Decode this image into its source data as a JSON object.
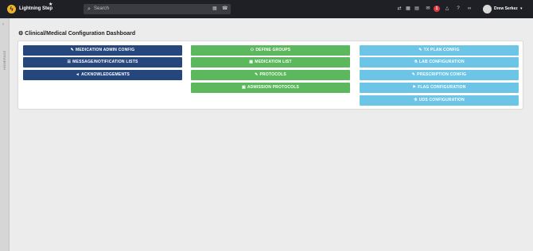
{
  "topbar": {
    "brand": "Lightning Step",
    "logo_glyph": "ϟ",
    "star_glyph": "★",
    "search_icon_glyph": "⌕",
    "search_placeholder": "Search",
    "calendar_glyph": "▦",
    "phone_glyph": "☎",
    "icons": {
      "transfer": "⇄",
      "calendar": "▦",
      "grid": "▤",
      "chat": "✉",
      "bell": "△",
      "help": "?",
      "link": "∞"
    },
    "notification_count": "1",
    "username": "Drew Serkez",
    "caret_glyph": "▾"
  },
  "sidebar": {
    "chevron_glyph": "‹",
    "label": "HOMEPAGE"
  },
  "page": {
    "title_icon_glyph": "⚙",
    "title": "Clinical/Medical Configuration Dashboard"
  },
  "buttons": {
    "col1": [
      {
        "icon": "✎",
        "label": "MEDICATION ADMIN CONFIG"
      },
      {
        "icon": "☰",
        "label": "MESSAGE/NOTIFICATION LISTS"
      },
      {
        "icon": "◄",
        "label": "ACKNOWLEDGEMENTS"
      }
    ],
    "col2": [
      {
        "icon": "⚇",
        "label": "DEFINE GROUPS"
      },
      {
        "icon": "▣",
        "label": "MEDICATION LIST"
      },
      {
        "icon": "✎",
        "label": "PROTOCOLS"
      },
      {
        "icon": "▣",
        "label": "ADMISSION PROTOCOLS"
      }
    ],
    "col3": [
      {
        "icon": "✎",
        "label": "TX PLAN CONFIG"
      },
      {
        "icon": "⚗",
        "label": "LAB CONFIGURATION"
      },
      {
        "icon": "✎",
        "label": "PRESCRIPTION CONFIG"
      },
      {
        "icon": "⚑",
        "label": "FLAG CONFIGURATION"
      },
      {
        "icon": "⚗",
        "label": "UDS CONFIGURATION"
      }
    ]
  },
  "colors": {
    "topbar": "#1f2025",
    "primary": "#26477d",
    "success": "#5cb85c",
    "info": "#6cc4e6",
    "badge": "#e0393e"
  }
}
